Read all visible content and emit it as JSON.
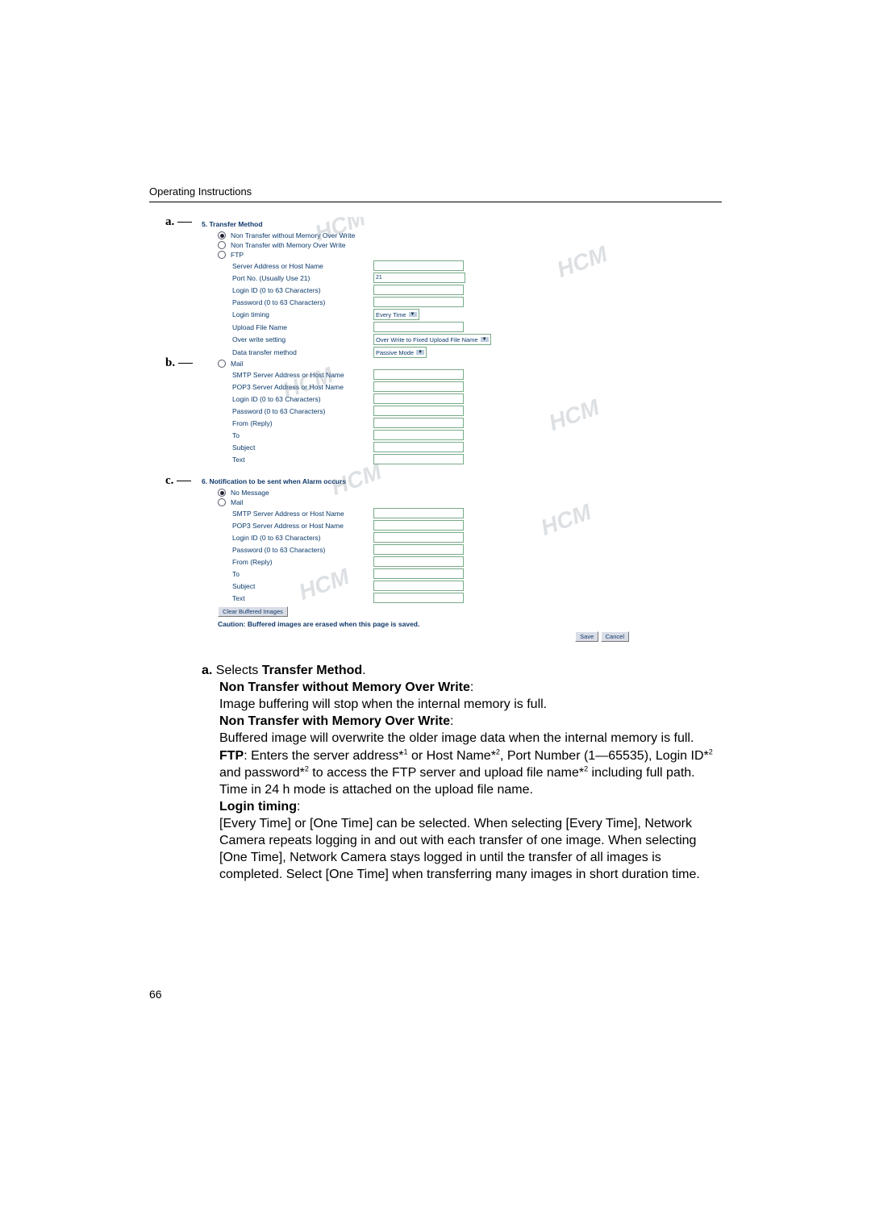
{
  "header": "Operating Instructions",
  "page_number": "66",
  "callouts": {
    "a": "a.",
    "b": "b.",
    "c": "c."
  },
  "fig": {
    "section5": {
      "title": "5.  Transfer Method",
      "opt1": "Non Transfer without Memory Over Write",
      "opt2": "Non Transfer with Memory Over Write",
      "opt3": "FTP",
      "ftp": {
        "server": "Server Address or Host Name",
        "port": "Port No. (Usually Use 21)",
        "port_value": "21",
        "login": "Login ID (0 to 63 Characters)",
        "pass": "Password (0 to 63 Characters)",
        "timing": "Login timing",
        "timing_value": "Every Time",
        "upfile": "Upload File Name",
        "overwrite": "Over write setting",
        "overwrite_value": "Over Write to Fixed Upload File Name",
        "method": "Data transfer method",
        "method_value": "Passive Mode"
      },
      "opt4": "Mail",
      "mail": {
        "smtp": "SMTP Server Address or Host Name",
        "pop3": "POP3 Server Address or Host Name",
        "login": "Login ID (0 to 63 Characters)",
        "pass": "Password (0 to 63 Characters)",
        "from": "From (Reply)",
        "to": "To",
        "subject": "Subject",
        "text": "Text"
      }
    },
    "section6": {
      "title": "6.  Notification to be sent when Alarm occurs",
      "opt1": "No Message",
      "opt2": "Mail",
      "mail": {
        "smtp": "SMTP Server Address or Host Name",
        "pop3": "POP3 Server Address or Host Name",
        "login": "Login ID (0 to 63 Characters)",
        "pass": "Password (0 to 63 Characters)",
        "from": "From (Reply)",
        "to": "To",
        "subject": "Subject",
        "text": "Text"
      }
    },
    "clear_btn": "Clear Buffered Images",
    "caution": "Caution: Buffered images are erased when this page is saved.",
    "save": "Save",
    "cancel": "Cancel"
  },
  "body": {
    "a_prefix": "a.",
    "a_line1": " Selects ",
    "a_line1b": "Transfer Method",
    "nt_without": "Non Transfer without Memory Over Write",
    "nt_without_desc": "Image buffering will stop when the internal memory is full.",
    "nt_with": "Non Transfer with Memory Over Write",
    "nt_with_desc": "Buffered image will overwrite the older image data when the internal memory is full.",
    "ftp": "FTP",
    "ftp_desc_1": ": Enters the server address*",
    "ftp_sup1": "1",
    "ftp_desc_2": " or Host Name*",
    "ftp_sup2": "2",
    "ftp_desc_3": ", Port Number (1—65535), Login ID*",
    "ftp_sup3": "2",
    "ftp_desc_4": " and password*",
    "ftp_sup4": "2",
    "ftp_desc_5": " to access the FTP server and upload file name*",
    "ftp_sup5": "2",
    "ftp_desc_6": " including full path. Time in 24 h mode is attached on the upload file name.",
    "login_timing": "Login timing",
    "login_timing_desc": "[Every Time] or [One Time] can be selected. When selecting [Every Time], Network Camera repeats logging in and out with each transfer of one image. When selecting [One Time], Network Camera stays logged in until the transfer of all images is completed. Select [One Time] when transferring many images in short duration time."
  }
}
